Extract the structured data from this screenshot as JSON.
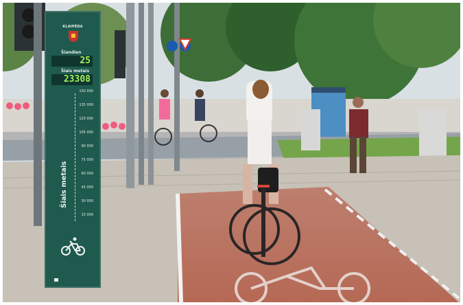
{
  "scene": {
    "description_text": "",
    "counter": {
      "city": "KLAIPĖDA",
      "today_label": "Šiandien",
      "today_value": "25",
      "year_label": "Šiais metais",
      "year_value": "23308",
      "scale": [
        "150 000",
        "135 000",
        "120 000",
        "105 000",
        "90 000",
        "75 000",
        "60 000",
        "45 000",
        "30 000",
        "15 000"
      ],
      "vertical_label": "Šiais metais",
      "bike_icon": "bicycle-icon"
    },
    "colors": {
      "sky": "#c9d5df",
      "trees": "#4c7a3c",
      "brick_path": "#b7705f",
      "sidewalk": "#c7c1b7",
      "counter": "#1f5a4e",
      "digits": "#9ff25b"
    }
  }
}
